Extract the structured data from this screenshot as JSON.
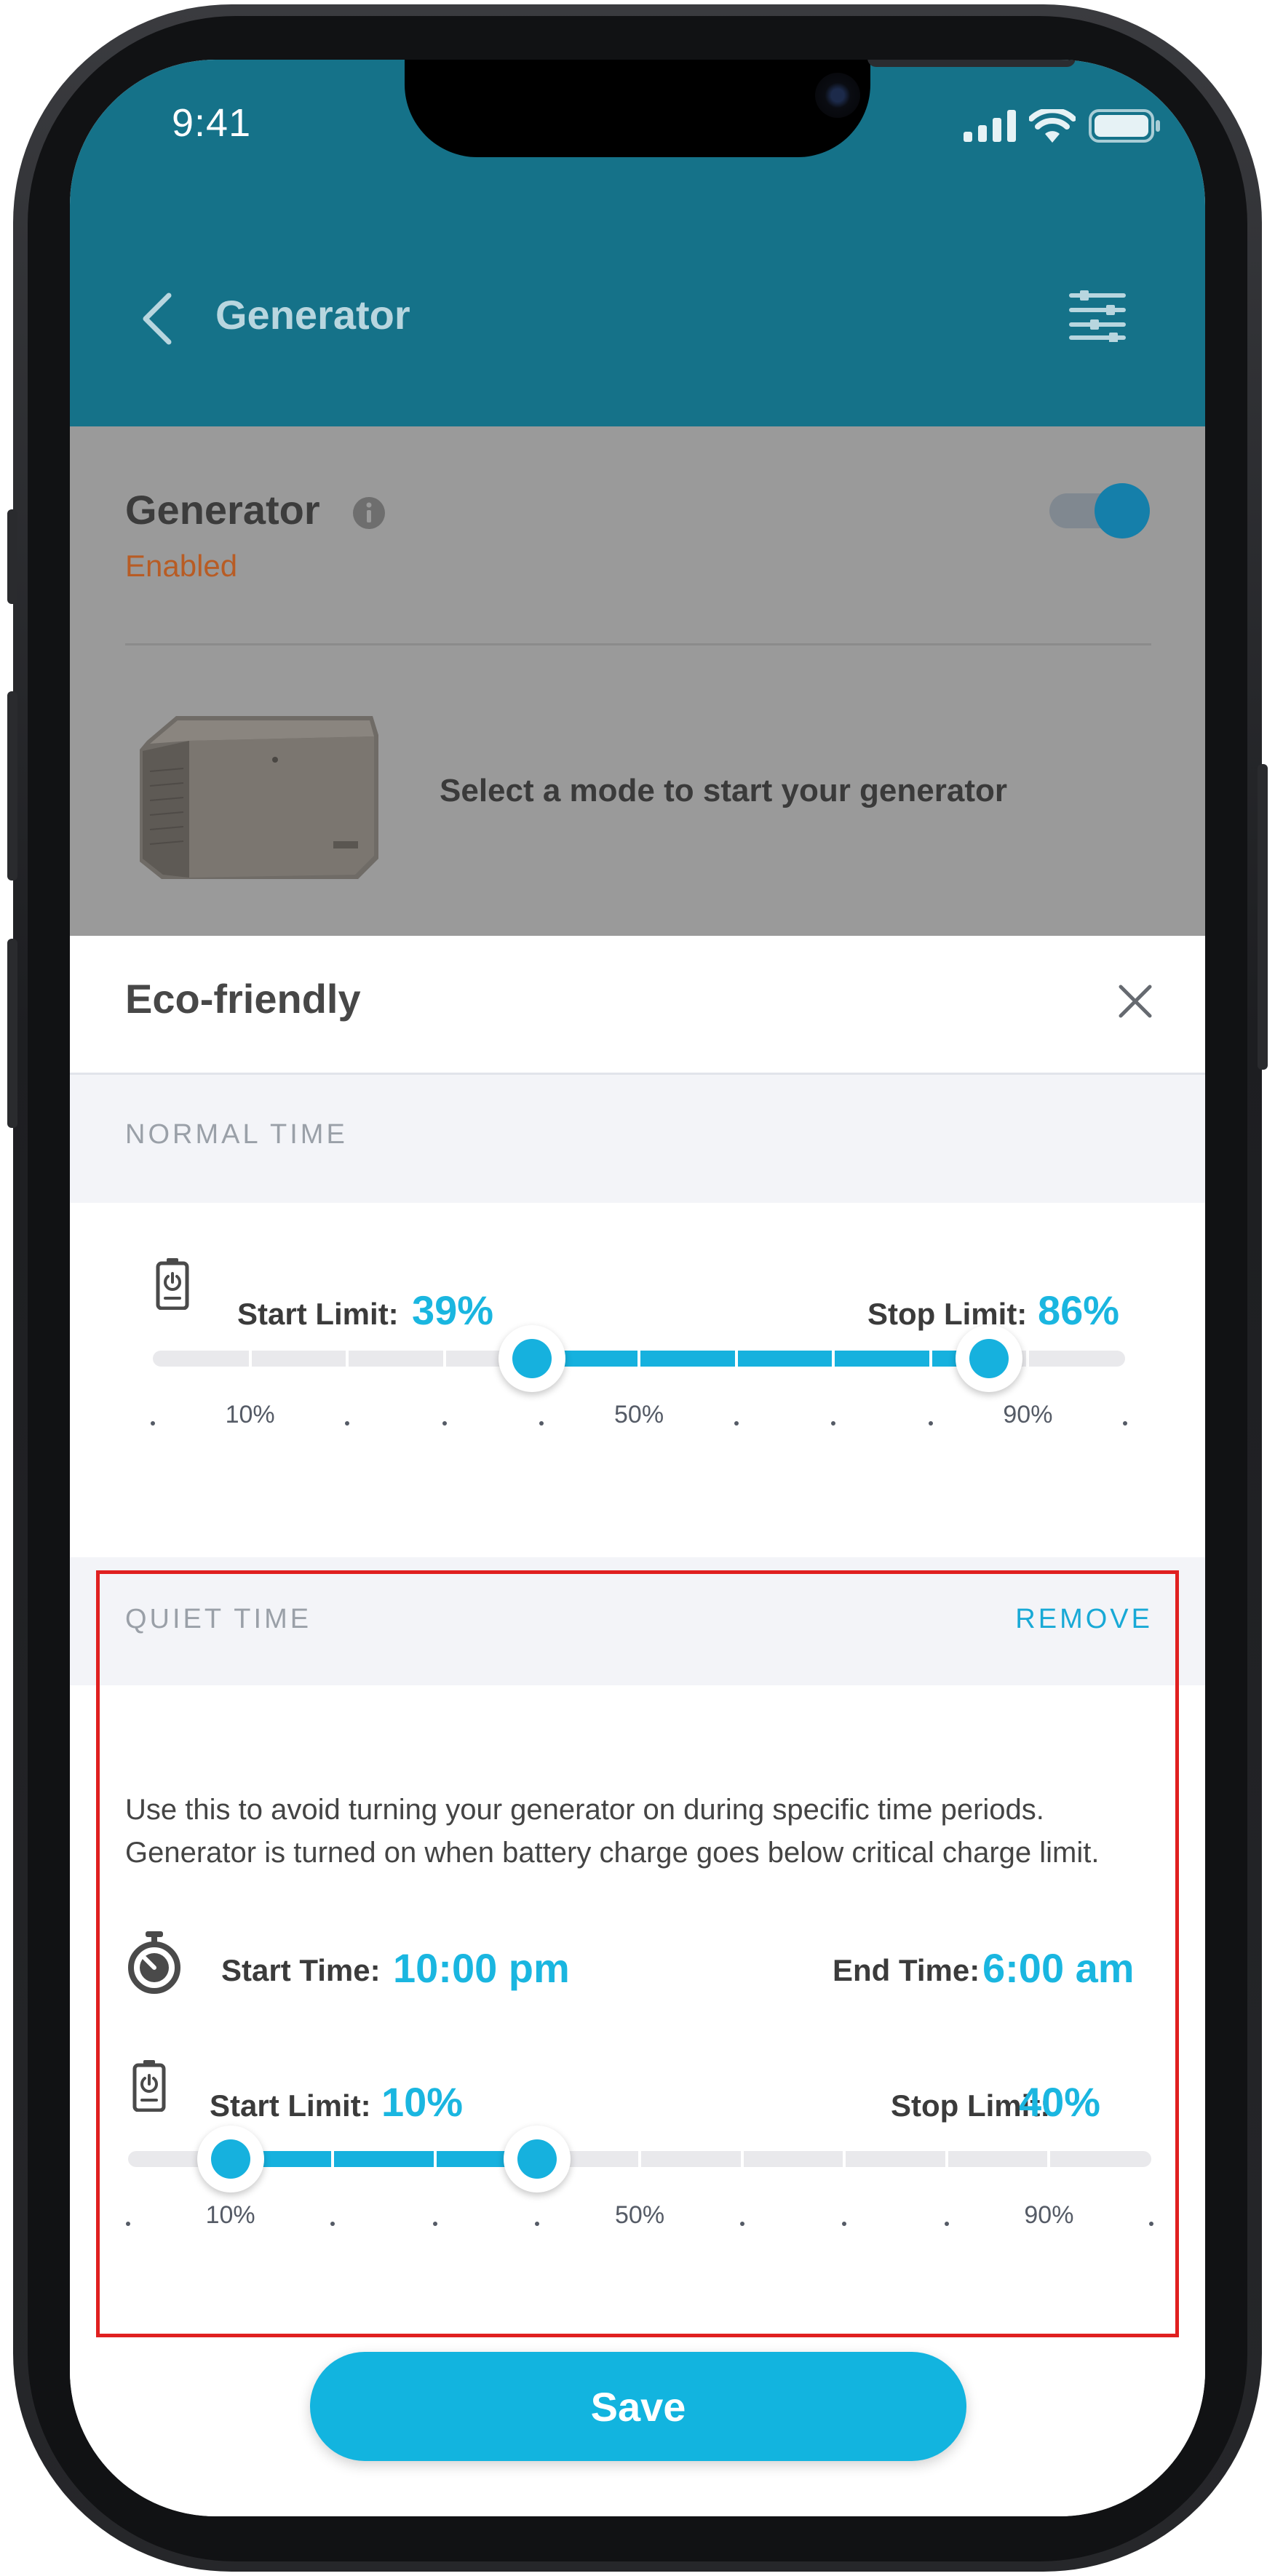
{
  "status_bar": {
    "time": "9:41"
  },
  "header": {
    "title": "Generator"
  },
  "generator": {
    "title": "Generator",
    "status": "Enabled",
    "enabled": true,
    "mode_prompt": "Select a mode to start your generator"
  },
  "sheet": {
    "title": "Eco-friendly",
    "normal_time": {
      "section_label": "NORMAL TIME",
      "start_label": "Start Limit:",
      "start_value": "39%",
      "stop_label": "Stop Limit:",
      "stop_value": "86%",
      "start_percent": 39,
      "stop_percent": 86,
      "scale": {
        "p10": "10%",
        "p50": "50%",
        "p90": "90%"
      }
    },
    "quiet_time": {
      "section_label": "QUIET TIME",
      "remove_label": "REMOVE",
      "description": "Use this to avoid turning your generator on during specific time periods. Generator is turned on when battery charge goes below critical charge limit.",
      "start_time_label": "Start Time:",
      "start_time_value": "10:00 pm",
      "end_time_label": "End Time:",
      "end_time_value": "6:00 am",
      "start_label": "Start Limit:",
      "start_value": "10%",
      "stop_label": "Stop Limit:",
      "stop_value": "40%",
      "start_percent": 10,
      "stop_percent": 40,
      "scale": {
        "p10": "10%",
        "p50": "50%",
        "p90": "90%"
      }
    },
    "save_label": "Save"
  },
  "colors": {
    "header_bg": "#157289",
    "accent": "#16b1de",
    "status_enabled": "#b85c24",
    "highlight": "#e02020"
  }
}
